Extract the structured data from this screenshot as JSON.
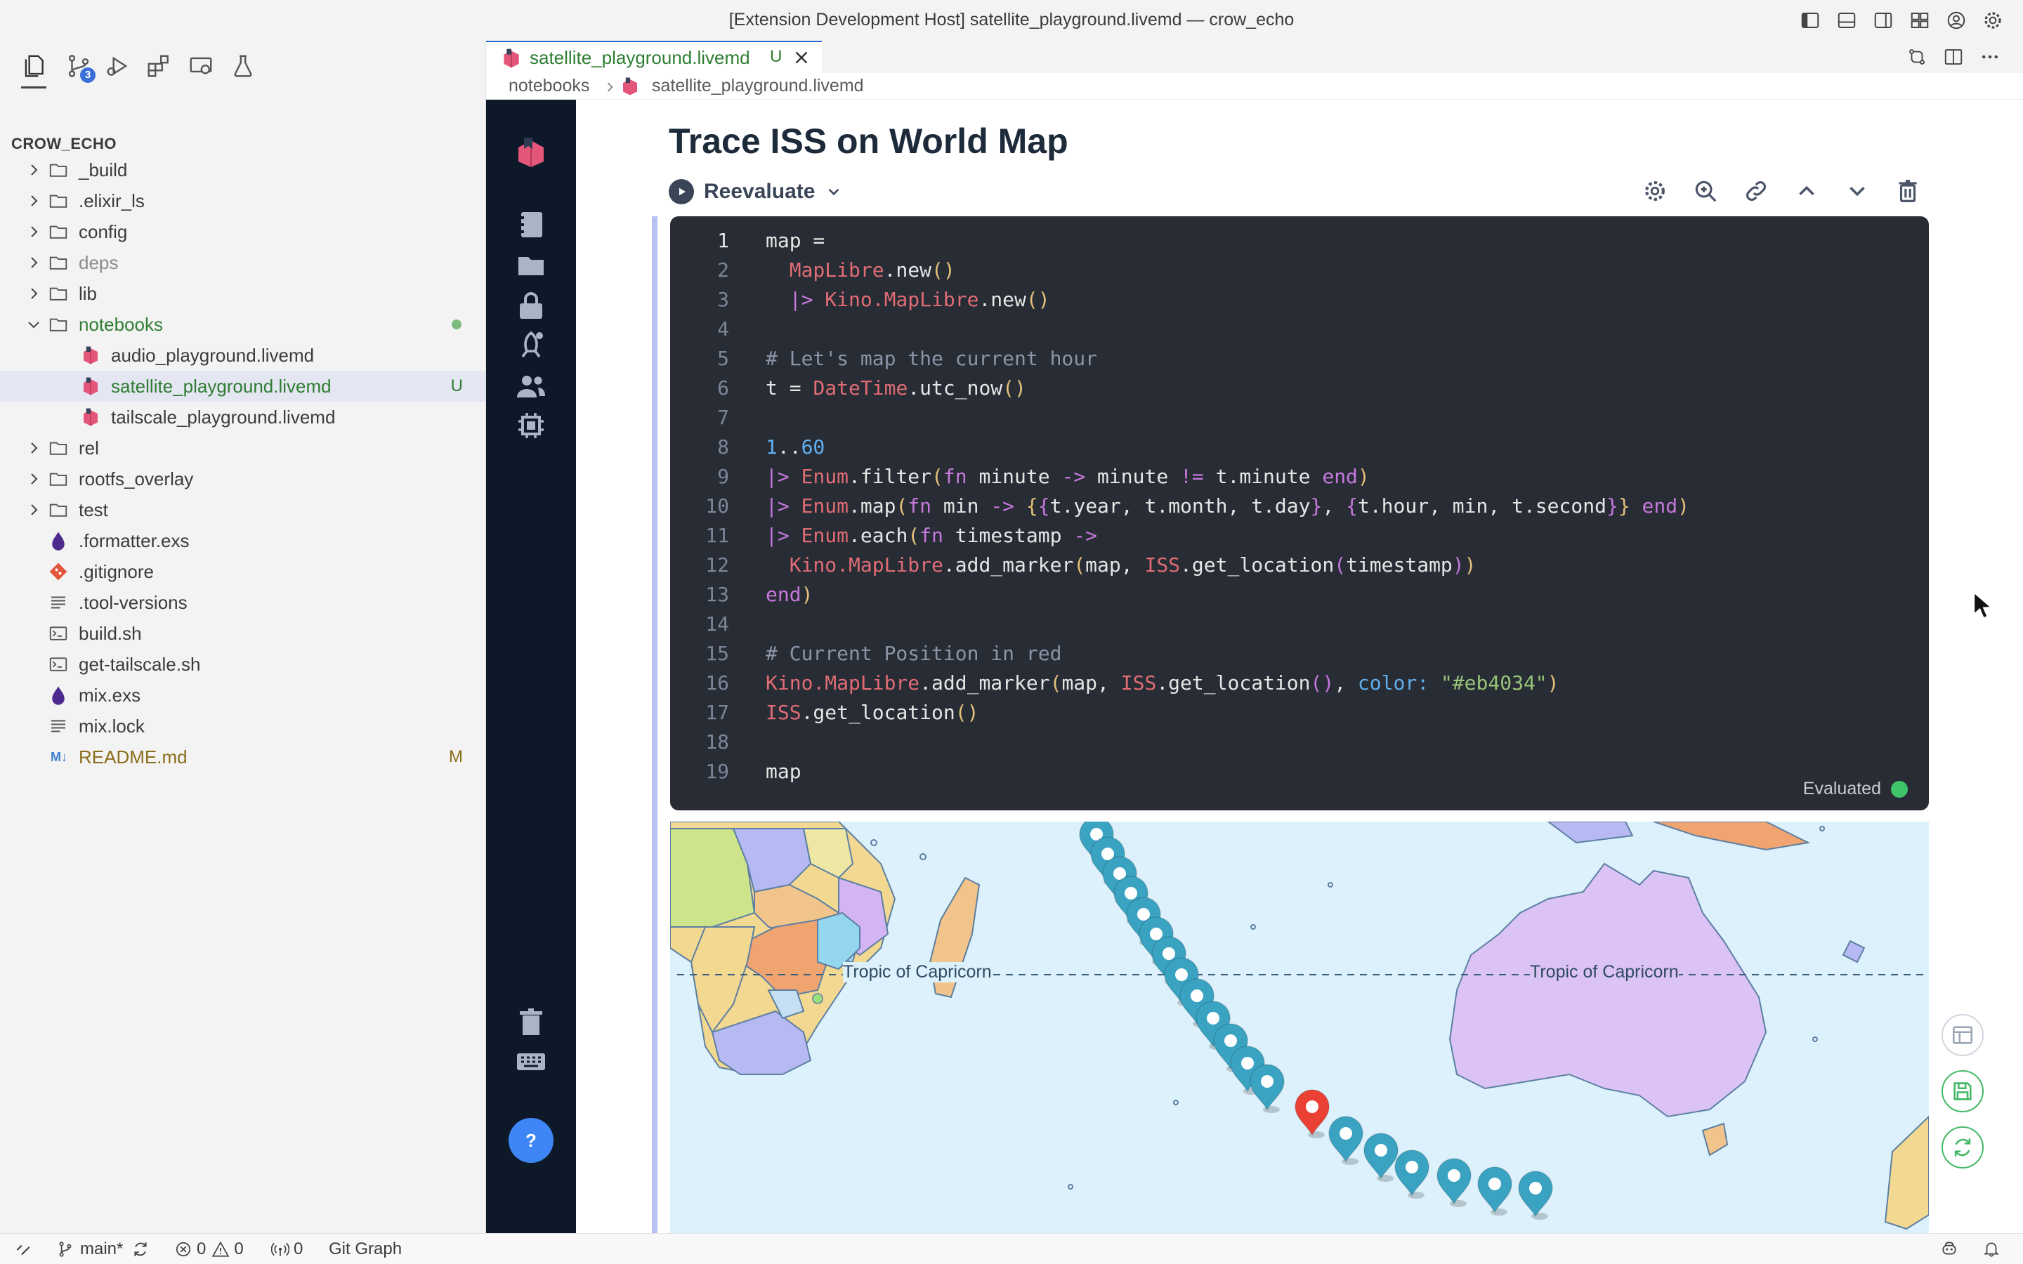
{
  "window": {
    "title": "[Extension Development Host] satellite_playground.livemd — crow_echo"
  },
  "activity_bar": {
    "scm_badge": "3"
  },
  "explorer": {
    "root": "CROW_ECHO",
    "items": [
      {
        "label": "_build",
        "kind": "folder",
        "deco": ""
      },
      {
        "label": ".elixir_ls",
        "kind": "folder",
        "deco": ""
      },
      {
        "label": "config",
        "kind": "folder",
        "deco": ""
      },
      {
        "label": "deps",
        "kind": "folder",
        "deco": ""
      },
      {
        "label": "lib",
        "kind": "folder",
        "deco": ""
      },
      {
        "label": "notebooks",
        "kind": "folder-open",
        "deco": ""
      },
      {
        "label": "audio_playground.livemd",
        "kind": "livemd",
        "deco": ""
      },
      {
        "label": "satellite_playground.livemd",
        "kind": "livemd",
        "deco": "U"
      },
      {
        "label": "tailscale_playground.livemd",
        "kind": "livemd",
        "deco": ""
      },
      {
        "label": "rel",
        "kind": "folder",
        "deco": ""
      },
      {
        "label": "rootfs_overlay",
        "kind": "folder",
        "deco": ""
      },
      {
        "label": "test",
        "kind": "folder",
        "deco": ""
      },
      {
        "label": ".formatter.exs",
        "kind": "exs",
        "deco": ""
      },
      {
        "label": ".gitignore",
        "kind": "git",
        "deco": ""
      },
      {
        "label": ".tool-versions",
        "kind": "lines",
        "deco": ""
      },
      {
        "label": "build.sh",
        "kind": "shell",
        "deco": ""
      },
      {
        "label": "get-tailscale.sh",
        "kind": "shell",
        "deco": ""
      },
      {
        "label": "mix.exs",
        "kind": "exs",
        "deco": ""
      },
      {
        "label": "mix.lock",
        "kind": "lines",
        "deco": ""
      },
      {
        "label": "README.md",
        "kind": "md",
        "deco": "M"
      }
    ],
    "md_icon_text": "M↓"
  },
  "editor": {
    "tab_label": "satellite_playground.livemd",
    "tab_status": "U",
    "breadcrumb": [
      "notebooks",
      "satellite_playground.livemd"
    ]
  },
  "notebook": {
    "section_title": "Trace ISS on World Map",
    "reevaluate_label": "Reevaluate",
    "eval_status": "Evaluated",
    "help_label": "?",
    "code_lines": [
      "map =",
      "  MapLibre.new()",
      "  |> Kino.MapLibre.new()",
      "",
      "# Let's map the current hour",
      "t = DateTime.utc_now()",
      "",
      "1..60",
      "|> Enum.filter(fn minute -> minute != t.minute end)",
      "|> Enum.map(fn min -> {{t.year, t.month, t.day}, {t.hour, min, t.second}} end)",
      "|> Enum.each(fn timestamp ->",
      "  Kino.MapLibre.add_marker(map, ISS.get_location(timestamp))",
      "end)",
      "",
      "# Current Position in red",
      "Kino.MapLibre.add_marker(map, ISS.get_location(), color: \"#eb4034\")",
      "ISS.get_location()",
      "",
      "map"
    ],
    "map": {
      "label_left": "Tropic of Capricorn",
      "label_right": "Tropic of Capricorn",
      "marker_color": "#3aa3c2",
      "current_marker_color": "#eb4034"
    }
  },
  "statusbar": {
    "branch": "main*",
    "errors": "0",
    "warnings": "0",
    "ports": "0",
    "git_graph": "Git Graph"
  }
}
